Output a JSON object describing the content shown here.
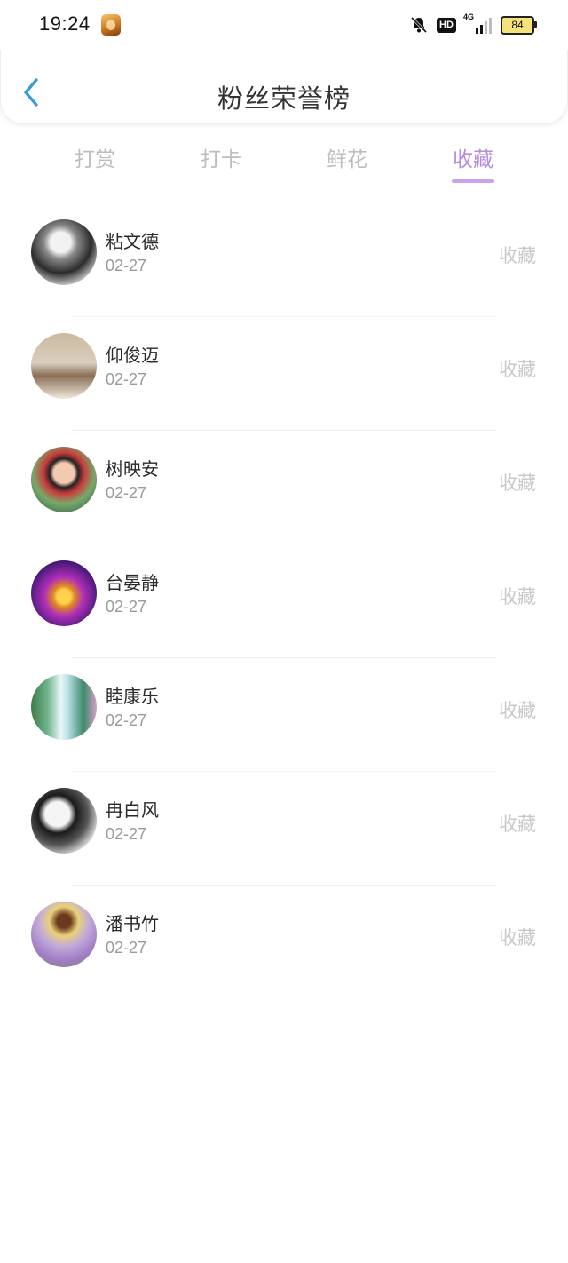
{
  "status_bar": {
    "time": "19:24",
    "network": "4G",
    "hd": "HD",
    "battery": "84"
  },
  "header": {
    "title": "粉丝荣誉榜"
  },
  "tabs": [
    {
      "label": "打赏",
      "active": false
    },
    {
      "label": "打卡",
      "active": false
    },
    {
      "label": "鲜花",
      "active": false
    },
    {
      "label": "收藏",
      "active": true
    }
  ],
  "colors": {
    "accent": "#b78be0",
    "back_arrow": "#3a9bdc",
    "inactive": "#bdbdbd"
  },
  "list": [
    {
      "name": "粘文德",
      "date": "02-27",
      "action": "收藏"
    },
    {
      "name": "仰俊迈",
      "date": "02-27",
      "action": "收藏"
    },
    {
      "name": "树映安",
      "date": "02-27",
      "action": "收藏"
    },
    {
      "name": "台晏静",
      "date": "02-27",
      "action": "收藏"
    },
    {
      "name": "睦康乐",
      "date": "02-27",
      "action": "收藏"
    },
    {
      "name": "冉白风",
      "date": "02-27",
      "action": "收藏"
    },
    {
      "name": "潘书竹",
      "date": "02-27",
      "action": "收藏"
    }
  ]
}
